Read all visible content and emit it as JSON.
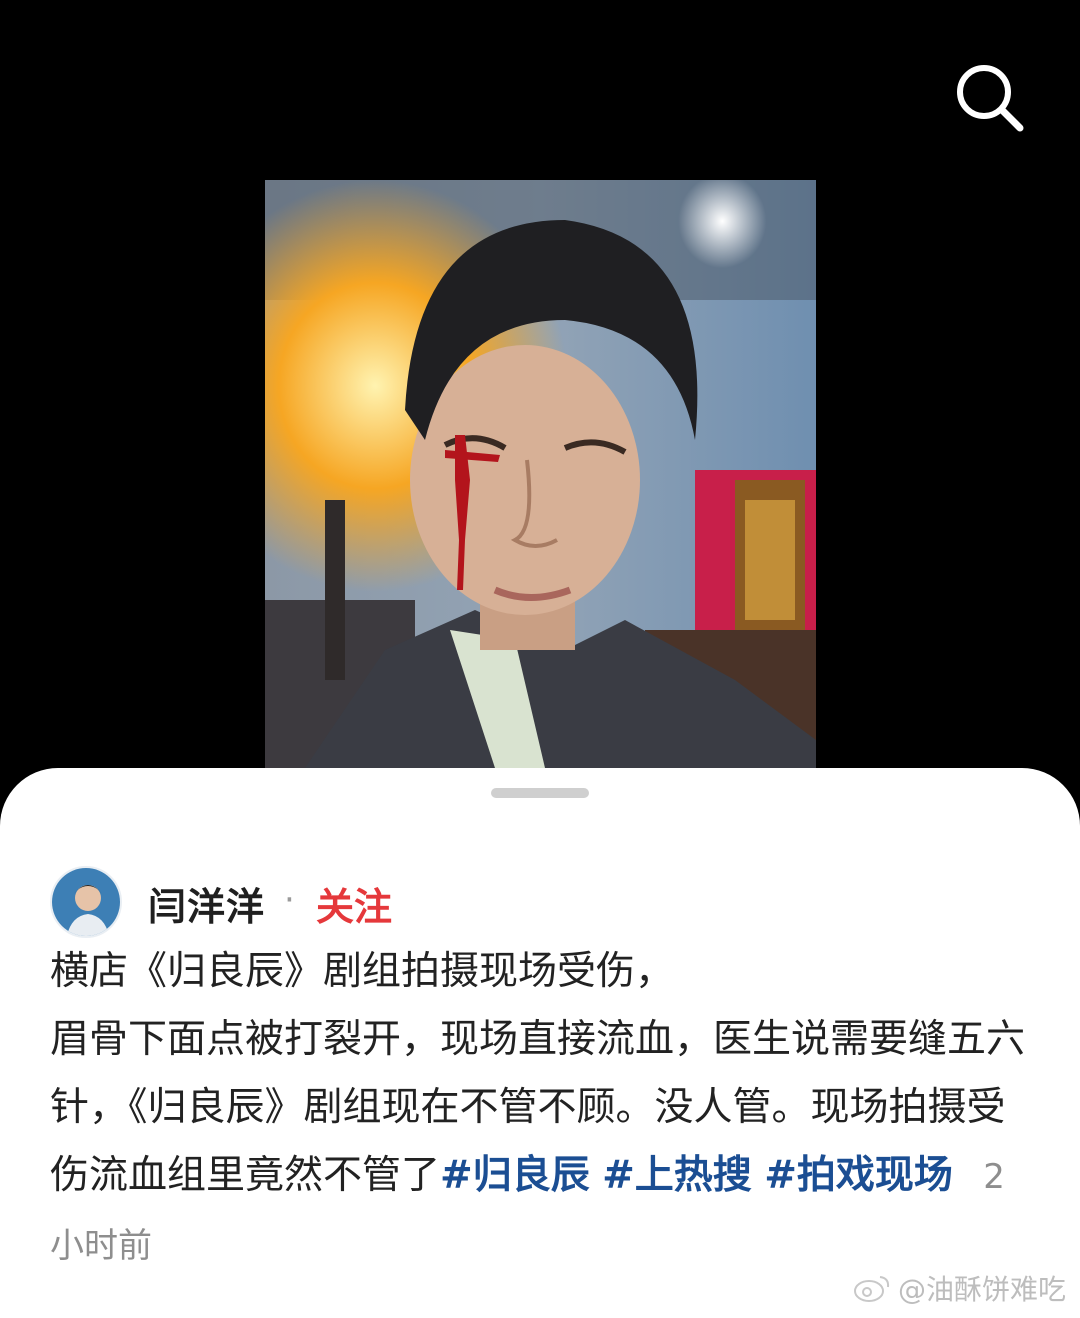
{
  "toolbar": {
    "search_icon": "search-icon"
  },
  "post": {
    "author": "闫洋洋",
    "separator": "·",
    "follow_label": "关注",
    "text_lines": [
      "横店《归良辰》剧组拍摄现场受伤，",
      "眉骨下面点被打裂开，现场直接流血，医生说需要缝五六针，《归良辰》剧组现在不管不顾。没人管。现场拍摄受伤流血组里竟然不管了"
    ],
    "hashtags": [
      "#归良辰",
      "#上热搜",
      "#拍戏现场"
    ],
    "time": "2小时前"
  },
  "watermark": {
    "text": "@油酥饼难吃"
  },
  "colors": {
    "accent_red": "#e5383b",
    "hashtag_blue": "#1b4e93",
    "background": "#000000",
    "sheet": "#ffffff"
  }
}
